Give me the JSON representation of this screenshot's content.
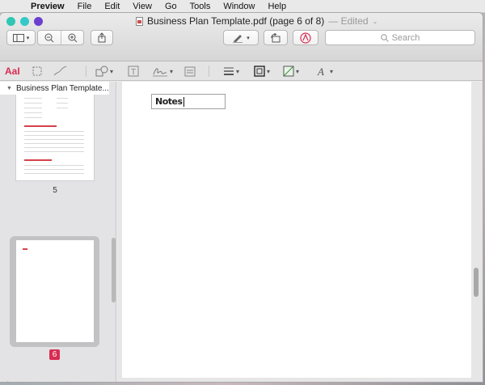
{
  "menubar": {
    "app_name": "Preview",
    "items": [
      "File",
      "Edit",
      "View",
      "Go",
      "Tools",
      "Window",
      "Help"
    ]
  },
  "window": {
    "title": "Business Plan Template.pdf (page 6 of 8)",
    "edited_label": "— Edited",
    "search_placeholder": "Search"
  },
  "markup": {
    "text_selection_label": "AaI"
  },
  "sidebar": {
    "document_name": "Business Plan Template...",
    "pages": [
      {
        "label": "5"
      },
      {
        "label": "6",
        "selected": true
      }
    ]
  },
  "document": {
    "text_field_value": "Notes"
  },
  "colors": {
    "accent_red": "#d82c52",
    "thumb_heading": "#d3424a"
  }
}
